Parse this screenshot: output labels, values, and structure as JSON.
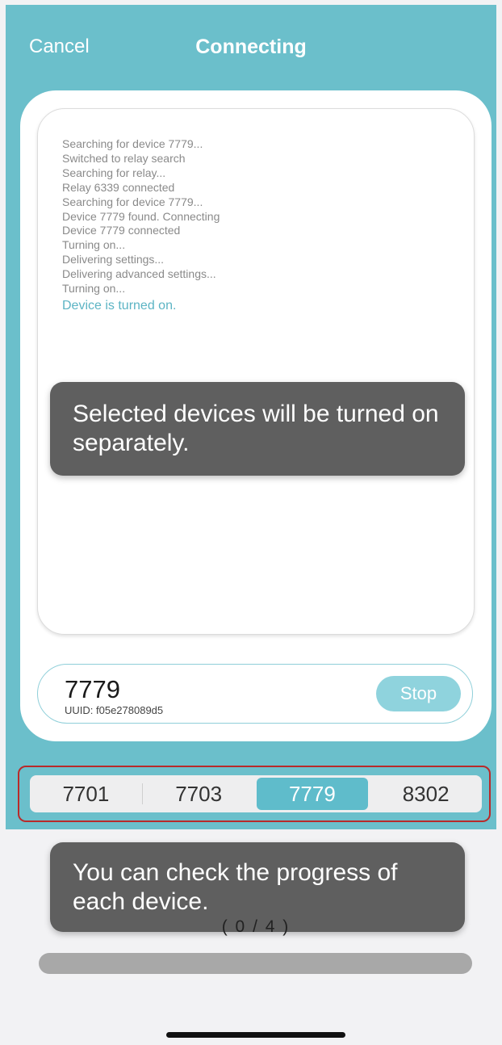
{
  "header": {
    "cancel_label": "Cancel",
    "title": "Connecting"
  },
  "log": {
    "lines": [
      "Searching for device 7779...",
      "Switched to relay search",
      "Searching for relay...",
      "Relay 6339 connected",
      "Searching for device 7779...",
      "Device 7779 found. Connecting",
      "Device 7779 connected",
      "Turning on...",
      "Delivering settings...",
      "Delivering advanced settings...",
      "Turning on..."
    ],
    "final_status": "Device is turned on."
  },
  "tooltips": {
    "selected_devices": "Selected devices will be turned on separately.",
    "progress_hint": "You can check the progress of each device."
  },
  "current_device": {
    "id": "7779",
    "uuid_label": "UUID: f05e278089d5",
    "stop_label": "Stop"
  },
  "device_tabs": [
    {
      "label": "7701",
      "active": false
    },
    {
      "label": "7703",
      "active": false
    },
    {
      "label": "7779",
      "active": true
    },
    {
      "label": "8302",
      "active": false
    }
  ],
  "progress": {
    "label": "( 0 / 4 )",
    "fraction": 0
  },
  "colors": {
    "teal": "#6bbfcb",
    "accent_text": "#5cb4c4",
    "highlight_border": "#b92a2a"
  }
}
